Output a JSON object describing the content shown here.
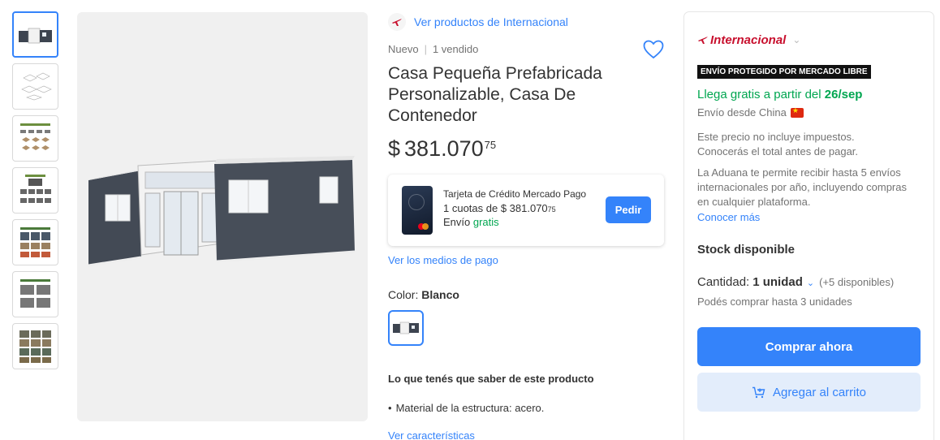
{
  "seller": {
    "link_label": "Ver productos de Internacional",
    "brand_name": "Internacional"
  },
  "product": {
    "condition": "Nuevo",
    "sold": "1 vendido",
    "title": "Casa Pequeña Prefabricada Personalizable, Casa De Contenedor",
    "price_currency": "$",
    "price_integer": "381.070",
    "price_cents": "75"
  },
  "card_offer": {
    "title": "Tarjeta de Crédito Mercado Pago",
    "installments_prefix": "1 cuotas de $ 381.070",
    "installments_cents": "75",
    "shipping_prefix": "Envío",
    "shipping_free": "gratis",
    "button_label": "Pedir"
  },
  "payment_link": "Ver los medios de pago",
  "color": {
    "label": "Color:",
    "value": "Blanco"
  },
  "features": {
    "heading": "Lo que tenés que saber de este producto",
    "items": [
      "Material de la estructura: acero."
    ],
    "link": "Ver características"
  },
  "buy_box": {
    "badge": "ENVÍO PROTEGIDO POR MERCADO LIBRE",
    "arrival_prefix": "Llega gratis a partir del",
    "arrival_date": "26/sep",
    "ships_from": "Envío desde China",
    "price_note_1": "Este precio no incluye impuestos.",
    "price_note_2": "Conocerás el total antes de pagar.",
    "customs_note": "La Aduana te permite recibir hasta 5 envíos internacionales por año, incluyendo compras en cualquier plataforma.",
    "learn_more": "Conocer más",
    "stock_label": "Stock disponible",
    "quantity_label": "Cantidad:",
    "quantity_value": "1 unidad",
    "available": "(+5 disponibles)",
    "limit": "Podés comprar hasta 3 unidades",
    "buy_now": "Comprar ahora",
    "add_to_cart": "Agregar al carrito"
  },
  "colors": {
    "accent": "#3483fa",
    "green": "#00a650",
    "brand_red": "#c8102e"
  }
}
